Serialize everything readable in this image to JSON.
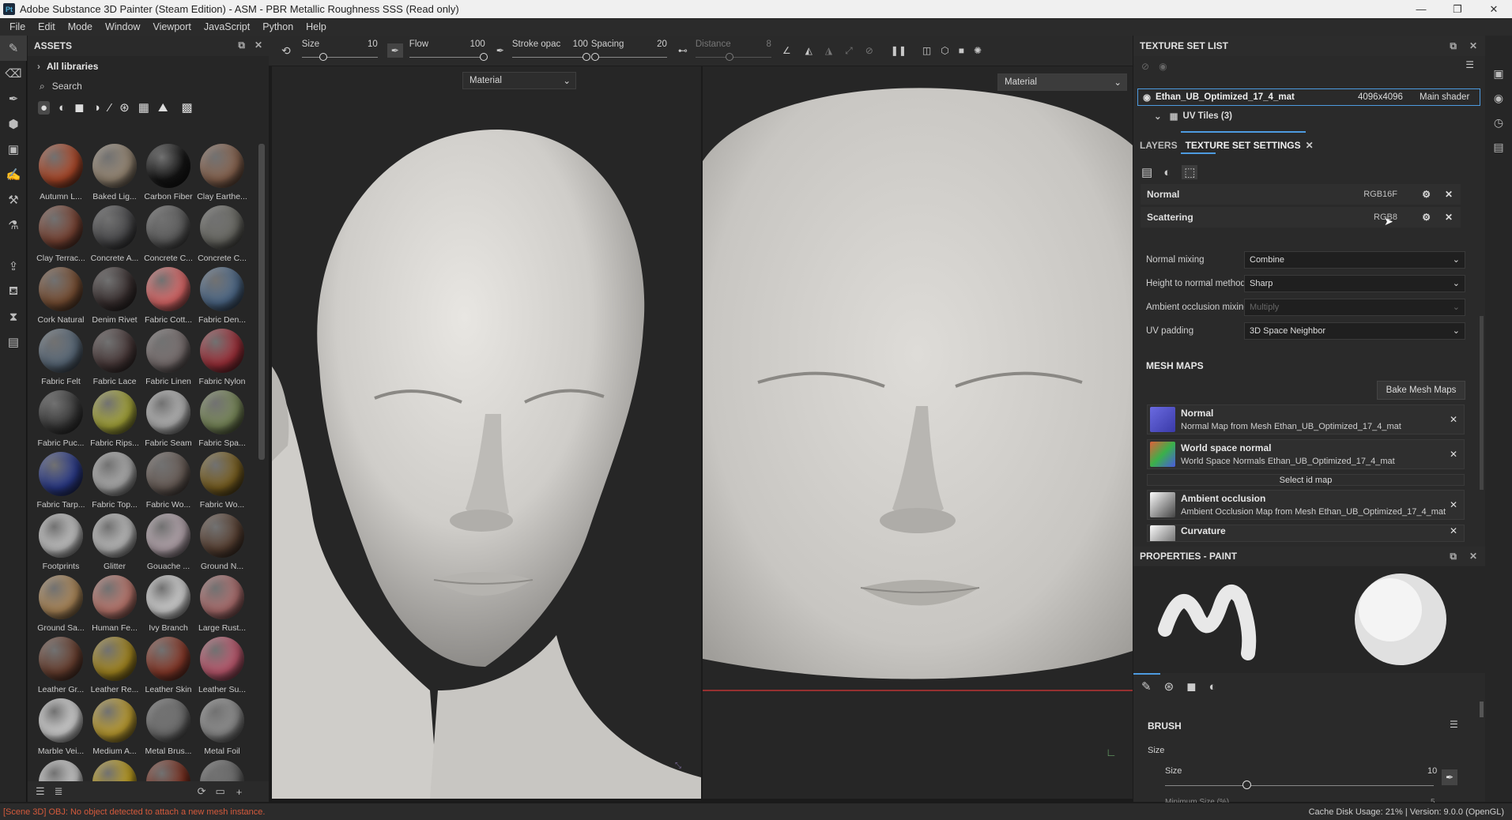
{
  "window": {
    "app_icon": "Pt",
    "title": "Adobe Substance 3D Painter (Steam Edition) - ASM - PBR Metallic Roughness SSS (Read only)",
    "controls": [
      "—",
      "❐",
      "✕"
    ]
  },
  "menu": [
    "File",
    "Edit",
    "Mode",
    "Window",
    "Viewport",
    "JavaScript",
    "Python",
    "Help"
  ],
  "assets": {
    "title": "ASSETS",
    "library": "All libraries",
    "search_placeholder": "Search",
    "items": [
      {
        "label": "Autumn L...",
        "color": "#b04a2a"
      },
      {
        "label": "Baked Lig...",
        "color": "#9a8a76"
      },
      {
        "label": "Carbon Fiber",
        "color": "#151515"
      },
      {
        "label": "Clay Earthe...",
        "color": "#8a6550"
      },
      {
        "label": "Clay Terrac...",
        "color": "#7a4434"
      },
      {
        "label": "Concrete A...",
        "color": "#4a4a4c"
      },
      {
        "label": "Concrete C...",
        "color": "#5e5e5e"
      },
      {
        "label": "Concrete C...",
        "color": "#6c6c66"
      },
      {
        "label": "Cork Natural",
        "color": "#7a5034"
      },
      {
        "label": "Denim Rivet",
        "color": "#3a3030"
      },
      {
        "label": "Fabric Cott...",
        "color": "#e06a6a"
      },
      {
        "label": "Fabric Den...",
        "color": "#4e6a8a"
      },
      {
        "label": "Fabric Felt",
        "color": "#5a6a7a"
      },
      {
        "label": "Fabric Lace",
        "color": "#4a3a3a"
      },
      {
        "label": "Fabric Linen",
        "color": "#7a7070"
      },
      {
        "label": "Fabric Nylon",
        "color": "#a0303a"
      },
      {
        "label": "Fabric Puc...",
        "color": "#3a3a3a"
      },
      {
        "label": "Fabric Rips...",
        "color": "#a8a83a"
      },
      {
        "label": "Fabric Seam",
        "color": "#b8b8b8"
      },
      {
        "label": "Fabric Spa...",
        "color": "#7a8a5a"
      },
      {
        "label": "Fabric Tarp...",
        "color": "#2a3a8a"
      },
      {
        "label": "Fabric Top...",
        "color": "#b0b0b0"
      },
      {
        "label": "Fabric Wo...",
        "color": "#6a5e58"
      },
      {
        "label": "Fabric Wo...",
        "color": "#7a6020"
      },
      {
        "label": "Footprints",
        "color": "#c8c8c8"
      },
      {
        "label": "Glitter",
        "color": "#c0c0c0"
      },
      {
        "label": "Gouache ...",
        "color": "#b8a8b0"
      },
      {
        "label": "Ground N...",
        "color": "#5a4234"
      },
      {
        "label": "Ground Sa...",
        "color": "#b08a5a"
      },
      {
        "label": "Human Fe...",
        "color": "#c07a70"
      },
      {
        "label": "Ivy Branch",
        "color": "#d8d8d8"
      },
      {
        "label": "Large Rust...",
        "color": "#b07070"
      },
      {
        "label": "Leather Gr...",
        "color": "#6a4030"
      },
      {
        "label": "Leather Re...",
        "color": "#a88a20"
      },
      {
        "label": "Leather Skin",
        "color": "#8a3a2a"
      },
      {
        "label": "Leather Su...",
        "color": "#c05a70"
      },
      {
        "label": "Marble Vei...",
        "color": "#d8d8d8"
      },
      {
        "label": "Medium A...",
        "color": "#c0a030"
      },
      {
        "label": "Metal Brus...",
        "color": "#707070"
      },
      {
        "label": "Metal Foil",
        "color": "#909090"
      },
      {
        "label": "",
        "color": "#d0d0d0"
      },
      {
        "label": "",
        "color": "#c0a020"
      },
      {
        "label": "",
        "color": "#7a3020"
      },
      {
        "label": "",
        "color": "#6a6a6a"
      }
    ]
  },
  "toolbar": {
    "size_label": "Size",
    "size_value": "10",
    "flow_label": "Flow",
    "flow_value": "100",
    "stroke_label": "Stroke opac",
    "stroke_value": "100",
    "spacing_label": "Spacing",
    "spacing_value": "20",
    "distance_label": "Distance",
    "distance_value": "8"
  },
  "viewport": {
    "left_mode": "Material",
    "right_mode": "Material"
  },
  "texture_set_list": {
    "title": "TEXTURE SET LIST",
    "set_name": "Ethan_UB_Optimized_17_4_mat",
    "resolution": "4096x4096",
    "shader": "Main shader",
    "uv_tiles": "UV Tiles (3)"
  },
  "tabs": {
    "layers": "LAYERS",
    "tss": "TEXTURE SET SETTINGS"
  },
  "channels": [
    {
      "name": "Normal",
      "format": "RGB16F"
    },
    {
      "name": "Scattering",
      "format": "RGB8"
    }
  ],
  "settings": [
    {
      "label": "Normal mixing",
      "value": "Combine",
      "disabled": false
    },
    {
      "label": "Height to normal method",
      "value": "Sharp",
      "disabled": false
    },
    {
      "label": "Ambient occlusion mixing",
      "value": "Multiply",
      "disabled": true
    },
    {
      "label": "UV padding",
      "value": "3D Space Neighbor",
      "disabled": false
    }
  ],
  "mesh_maps": {
    "title": "MESH MAPS",
    "bake_label": "Bake Mesh Maps",
    "select_id": "Select id map",
    "items": [
      {
        "name": "Normal",
        "desc": "Normal Map from Mesh Ethan_UB_Optimized_17_4_mat"
      },
      {
        "name": "World space normal",
        "desc": "World Space Normals Ethan_UB_Optimized_17_4_mat"
      },
      {
        "name": "Ambient occlusion",
        "desc": "Ambient Occlusion Map from Mesh Ethan_UB_Optimized_17_4_mat"
      },
      {
        "name": "Curvature",
        "desc": ""
      }
    ]
  },
  "properties": {
    "title": "PROPERTIES - PAINT",
    "brush_title": "BRUSH",
    "size_group": "Size",
    "size_label": "Size",
    "size_value": "10",
    "min_size_label": "Minimum Size (%)",
    "min_size_value": "5"
  },
  "status": {
    "message": "[Scene 3D] OBJ: No object detected to attach a new mesh instance.",
    "right": "Cache Disk Usage:   21% | Version: 9.0.0 (OpenGL)"
  },
  "colors": {
    "accent": "#4d9be0",
    "error": "#d45a3c"
  }
}
